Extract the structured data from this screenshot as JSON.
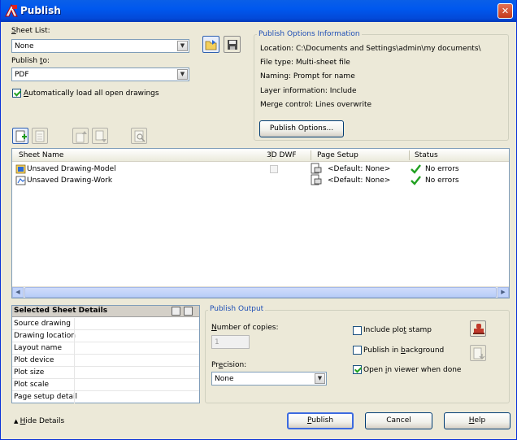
{
  "window": {
    "title": "Publish",
    "close_glyph": "✕"
  },
  "sheet_list": {
    "label_prefix": "",
    "label_underline": "S",
    "label_rest": "heet List:",
    "value": "None"
  },
  "publish_to": {
    "label_prefix": "Publish ",
    "label_underline": "t",
    "label_rest": "o:",
    "value": "PDF"
  },
  "auto_load": {
    "label_underline": "A",
    "label_rest": "utomatically load all open drawings",
    "checked": true
  },
  "options_info": {
    "title": "Publish Options Information",
    "location": "Location:  C:\\Documents and Settings\\admin\\my documents\\",
    "file_type": "File type: Multi-sheet file",
    "naming": "Naming: Prompt for name",
    "layer_info": "Layer information: Include",
    "merge_control": "Merge control: Lines overwrite",
    "button": "Publish Options..."
  },
  "sheet_table": {
    "columns": [
      "Sheet Name",
      "3D DWF",
      "Page Setup",
      "Status"
    ],
    "rows": [
      {
        "name": "Unsaved Drawing-Model",
        "page_setup": "<Default: None>",
        "status": "No errors"
      },
      {
        "name": "Unsaved Drawing-Work",
        "page_setup": "<Default: None>",
        "status": "No errors"
      }
    ]
  },
  "selected_details": {
    "title": "Selected Sheet Details",
    "fields": [
      "Source drawing",
      "Drawing location",
      "Layout name",
      "Plot device",
      "Plot size",
      "Plot scale",
      "Page setup detail"
    ]
  },
  "publish_output": {
    "title": "Publish Output",
    "copies_label_underline": "N",
    "copies_label_rest": "umber of copies:",
    "copies_value": "1",
    "precision_label_prefix": "Pr",
    "precision_label_underline": "e",
    "precision_label_rest": "cision:",
    "precision_value": "None",
    "include_stamp_label_prefix": "Include plo",
    "include_stamp_label_underline": "t",
    "include_stamp_label_rest": " stamp",
    "include_stamp_checked": false,
    "background_label_prefix": "Publish in ",
    "background_label_underline": "b",
    "background_label_rest": "ackground",
    "background_checked": false,
    "open_viewer_label_prefix": "Open ",
    "open_viewer_label_underline": "i",
    "open_viewer_label_rest": "n viewer when done",
    "open_viewer_checked": true
  },
  "footer": {
    "hide_details_underline": "H",
    "hide_details_rest": "ide Details",
    "publish_underline": "P",
    "publish_rest": "ublish",
    "cancel": "Cancel",
    "help_underline": "H",
    "help_rest": "elp"
  },
  "colors": {
    "title_blue": "#0058ee",
    "group_title": "#1f4fb5",
    "ok_green": "#21a121"
  }
}
